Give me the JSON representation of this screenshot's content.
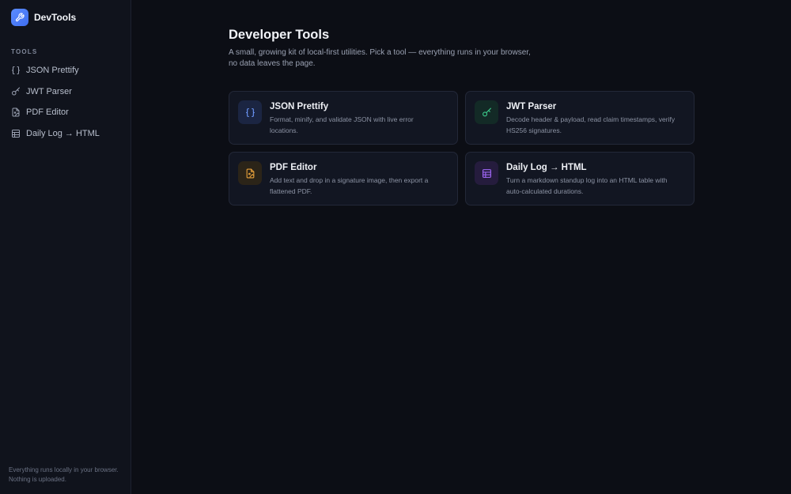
{
  "brand": {
    "name": "DevTools",
    "icon": "wrench-icon",
    "accent": "#4f7cff"
  },
  "sidebar": {
    "section_label": "TOOLS",
    "items": [
      {
        "label": "JSON Prettify",
        "icon": "braces-icon"
      },
      {
        "label": "JWT Parser",
        "icon": "key-icon"
      },
      {
        "label": "PDF Editor",
        "icon": "file-image-icon"
      },
      {
        "label": "Daily Log → HTML",
        "icon": "table-icon"
      }
    ],
    "footer_line1": "Everything runs locally in your browser.",
    "footer_line2": "Nothing is uploaded."
  },
  "main": {
    "title": "Developer Tools",
    "description_line1": "A small, growing kit of local-first utilities. Pick a tool — everything runs in your browser,",
    "description_line2": "no data leaves the page.",
    "cards": [
      {
        "title": "JSON Prettify",
        "desc_line1": "Format, minify, and validate JSON with live error",
        "desc_line2": "locations.",
        "icon": "braces-icon",
        "color": "#6f9bff"
      },
      {
        "title": "JWT Parser",
        "desc_line1": "Decode header & payload, read claim timestamps, verify",
        "desc_line2": "HS256 signatures.",
        "icon": "key-icon",
        "color": "#3ecf8e"
      },
      {
        "title": "PDF Editor",
        "desc_line1": "Add text and drop in a signature image, then export a",
        "desc_line2": "flattened PDF.",
        "icon": "file-image-icon",
        "color": "#e9a23b"
      },
      {
        "title": "Daily Log → HTML",
        "desc_line1": "Turn a markdown standup log into an HTML table with",
        "desc_line2": "auto-calculated durations.",
        "icon": "table-icon",
        "color": "#a66bff"
      }
    ]
  }
}
